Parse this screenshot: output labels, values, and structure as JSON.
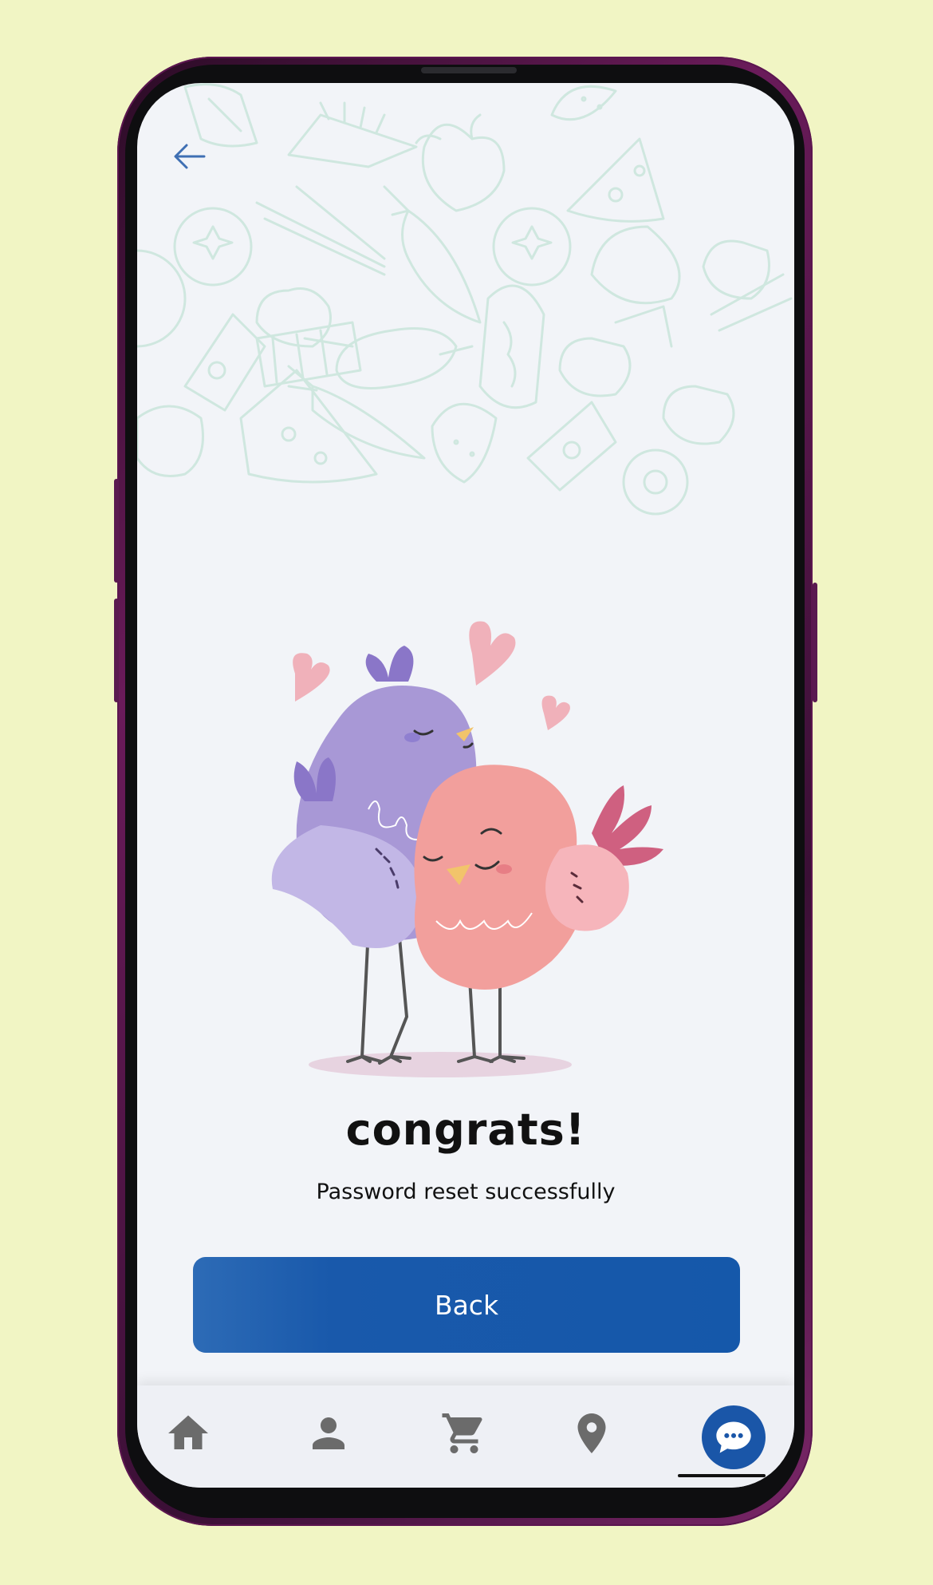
{
  "header": {
    "back_icon": "arrow-left-icon"
  },
  "main": {
    "title": "congrats!",
    "message": "Password reset successfully",
    "back_button_label": "Back",
    "illustration": "two-birds-with-hearts"
  },
  "bottom_nav": {
    "items": [
      {
        "icon": "home-icon"
      },
      {
        "icon": "person-icon"
      },
      {
        "icon": "cart-icon"
      },
      {
        "icon": "location-pin-icon"
      },
      {
        "icon": "chat-icon",
        "active": true
      }
    ]
  },
  "colors": {
    "background": "#f1f5c4",
    "primary": "#1558aa",
    "screen": "#f2f4f8",
    "nav_icon": "#5f6368",
    "doodle": "#cfe7df"
  }
}
